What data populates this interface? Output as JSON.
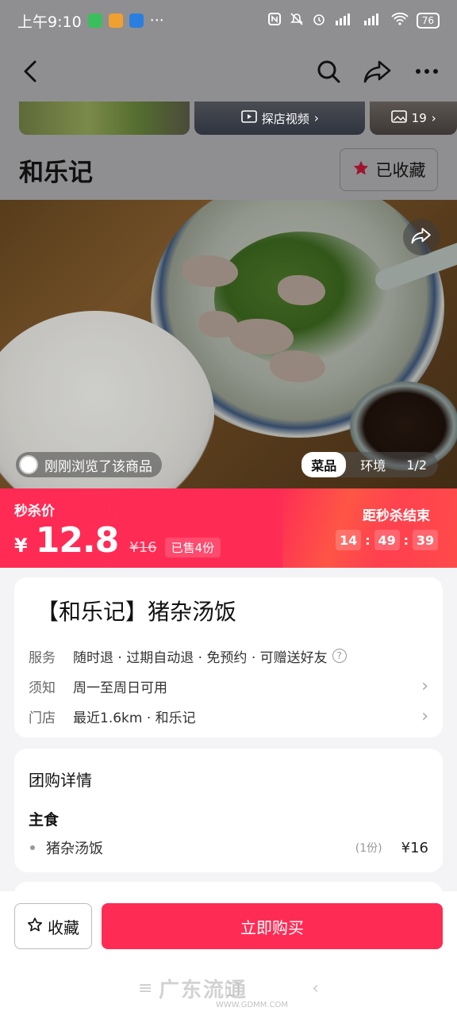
{
  "status_bar": {
    "time": "上午9:10",
    "battery": "76",
    "more": "···"
  },
  "thumbs": {
    "video_label": "探店视频",
    "photo_count": "19"
  },
  "shop": {
    "name": "和乐记",
    "fav_label": "已收藏"
  },
  "hero": {
    "viewed_text": "刚刚浏览了该商品",
    "tab_dish": "菜品",
    "tab_env": "环境",
    "page_indicator": "1/2"
  },
  "flash_sale": {
    "label": "秒杀价",
    "currency": "¥",
    "price": "12.8",
    "original_price": "¥16",
    "sold": "已售4份",
    "countdown_label": "距秒杀结束",
    "hours": "14",
    "minutes": "49",
    "seconds": "39"
  },
  "product": {
    "name": "【和乐记】猪杂汤饭",
    "service_key": "服务",
    "service_val": "随时退 · 过期自动退 · 免预约 · 可赠送好友",
    "notice_key": "须知",
    "notice_val": "周一至周日可用",
    "store_key": "门店",
    "store_val": "最近1.6km · 和乐记"
  },
  "details": {
    "title": "团购详情",
    "group": "主食",
    "items": [
      {
        "name": "猪杂汤饭",
        "qty": "(1份)",
        "price": "¥16"
      }
    ]
  },
  "bottom": {
    "collect_label": "收藏",
    "buy_label": "立即购买"
  },
  "watermark": {
    "main": "广东流通",
    "sub": "WWW.GDMM.COM"
  },
  "colors": {
    "accent": "#fe2c55",
    "dim_overlay": "#8f8f91"
  }
}
